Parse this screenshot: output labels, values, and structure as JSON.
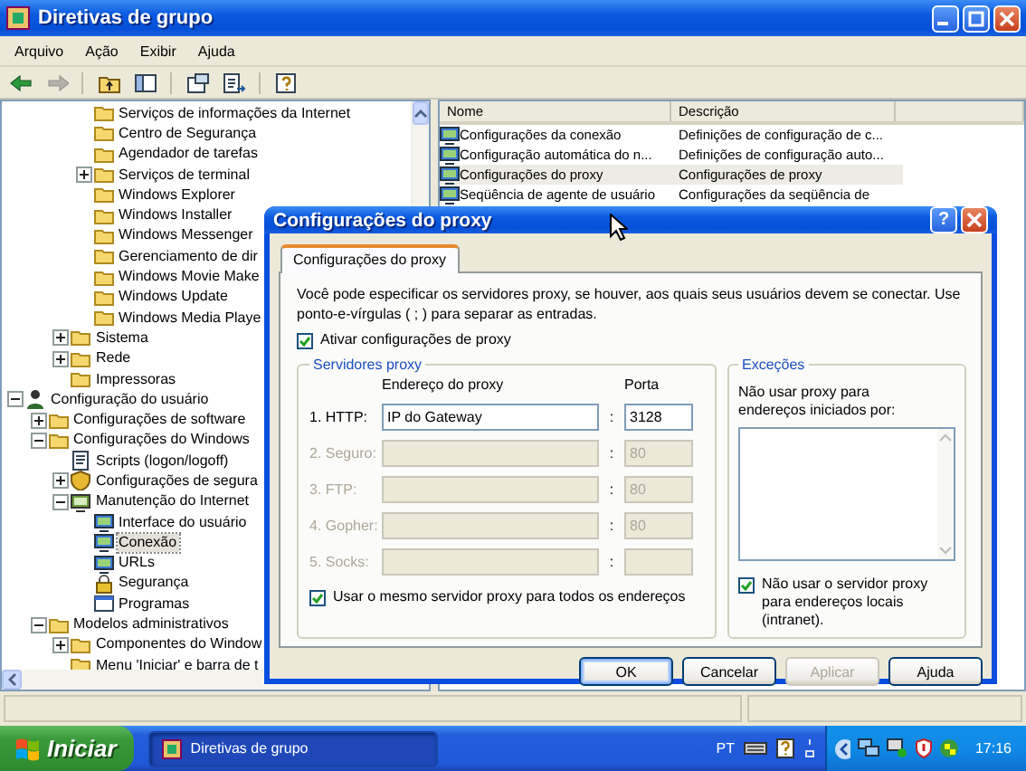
{
  "window": {
    "title": "Diretivas de grupo"
  },
  "menu": [
    {
      "label": "Arquivo"
    },
    {
      "label": "Ação"
    },
    {
      "label": "Exibir"
    },
    {
      "label": "Ajuda"
    }
  ],
  "toolbar": [
    {
      "kind": "back",
      "disabled": false
    },
    {
      "kind": "forward",
      "disabled": true
    },
    {
      "kind": "up",
      "disabled": false
    },
    {
      "kind": "tree",
      "disabled": false
    },
    {
      "kind": "properties",
      "disabled": false
    },
    {
      "kind": "export",
      "disabled": false
    },
    {
      "kind": "help",
      "disabled": false
    }
  ],
  "tree": [
    {
      "children": [
        {
          "children": [
            {
              "children": [
                {
                  "label": "Serviços de informações da Internet",
                  "kind": "folder",
                  "selected": false
                },
                {
                  "label": "Centro de Segurança",
                  "kind": "folder",
                  "selected": false
                },
                {
                  "label": "Agendador de tarefas",
                  "kind": "folder",
                  "selected": false
                },
                {
                  "label": "Serviços de terminal",
                  "kind": "folder",
                  "expanded": false,
                  "selected": false
                },
                {
                  "label": "Windows Explorer",
                  "kind": "folder",
                  "selected": false
                },
                {
                  "label": "Windows Installer",
                  "kind": "folder",
                  "selected": false
                },
                {
                  "label": "Windows Messenger",
                  "kind": "folder",
                  "selected": false
                },
                {
                  "label": "Gerenciamento de dir",
                  "kind": "folder",
                  "selected": false
                },
                {
                  "label": "Windows Movie Make",
                  "kind": "folder",
                  "selected": false
                },
                {
                  "label": "Windows Update",
                  "kind": "folder",
                  "selected": false
                },
                {
                  "label": "Windows Media Playe",
                  "kind": "folder",
                  "selected": false
                }
              ]
            },
            {
              "label": "Sistema",
              "kind": "folder",
              "expanded": false,
              "selected": false
            },
            {
              "label": "Rede",
              "kind": "folder",
              "expanded": false,
              "selected": false
            },
            {
              "label": "Impressoras",
              "kind": "folder",
              "selected": false
            }
          ]
        }
      ]
    },
    {
      "label": "Configuração do usuário",
      "kind": "user",
      "expanded": true,
      "selected": false,
      "children": [
        {
          "label": "Configurações de software",
          "kind": "folder",
          "expanded": false,
          "selected": false
        },
        {
          "label": "Configurações do Windows",
          "kind": "folder",
          "expanded": true,
          "selected": false,
          "children": [
            {
              "label": "Scripts (logon/logoff)",
              "kind": "document",
              "selected": false
            },
            {
              "label": "Configurações de segura",
              "kind": "shield",
              "expanded": false,
              "selected": false
            },
            {
              "label": "Manutenção do Internet",
              "kind": "computer",
              "expanded": true,
              "selected": false,
              "children": [
                {
                  "label": "Interface do usuário",
                  "kind": "monitor",
                  "selected": false
                },
                {
                  "label": "Conexão",
                  "kind": "monitor",
                  "selected": true
                },
                {
                  "label": "URLs",
                  "kind": "monitor",
                  "selected": false
                },
                {
                  "label": "Segurança",
                  "kind": "lock",
                  "selected": false
                },
                {
                  "label": "Programas",
                  "kind": "window",
                  "selected": false
                }
              ]
            }
          ]
        },
        {
          "label": "Modelos administrativos",
          "kind": "folder",
          "expanded": true,
          "selected": false,
          "children": [
            {
              "label": "Componentes do Window",
              "kind": "folder",
              "expanded": false,
              "selected": false
            },
            {
              "label": "Menu 'Iniciar' e barra de t",
              "kind": "folder",
              "selected": false
            }
          ]
        }
      ]
    }
  ],
  "list": {
    "columns": [
      "Nome",
      "Descrição"
    ],
    "rows": [
      {
        "name": "Configurações da conexão",
        "description": "Definições de configuração de c...",
        "selected": false
      },
      {
        "name": "Configuração automática do n...",
        "description": "Definições de configuração auto...",
        "selected": false
      },
      {
        "name": "Configurações do proxy",
        "description": "Configurações de proxy",
        "selected": true
      },
      {
        "name": "Seqüência de agente de usuário",
        "description": "Configurações da seqüência de",
        "selected": false
      }
    ]
  },
  "dialog": {
    "title": "Configurações do proxy",
    "help_button": "?",
    "tabs": [
      {
        "label": "Configurações do proxy",
        "selected": true
      }
    ],
    "intro": "Você pode especificar os servidores proxy, se houver, aos quais seus usuários devem se conectar. Use ponto-e-vírgulas ( ; ) para separar as entradas.",
    "enable_proxy": {
      "label": "Ativar configurações de proxy",
      "checked": true
    },
    "servers": {
      "title": "Servidores proxy",
      "address_heading": "Endereço do proxy",
      "port_heading": "Porta",
      "rows": [
        {
          "label": "1. HTTP:",
          "address": "IP do Gateway",
          "separator": ":",
          "port": "3128",
          "disabled": false
        },
        {
          "label": "2. Seguro:",
          "separator": ":",
          "port": "80",
          "disabled": true
        },
        {
          "label": "3. FTP:",
          "separator": ":",
          "port": "80",
          "disabled": true
        },
        {
          "label": "4. Gopher:",
          "separator": ":",
          "port": "80",
          "disabled": true
        },
        {
          "label": "5. Socks:",
          "separator": ":",
          "disabled": true
        }
      ],
      "same_proxy": {
        "label": "Usar o mesmo servidor proxy para todos os endereços",
        "checked": true
      }
    },
    "exceptions": {
      "title": "Exceções",
      "label": "Não usar proxy para endereços iniciados por:",
      "bypass_local": {
        "label": "Não usar o servidor proxy para endereços locais (intranet).",
        "checked": true
      }
    },
    "buttons": [
      {
        "label": "OK",
        "default": true,
        "disabled": false
      },
      {
        "label": "Cancelar",
        "default": false,
        "disabled": false
      },
      {
        "label": "Aplicar",
        "default": false,
        "disabled": true
      },
      {
        "label": "Ajuda",
        "default": false,
        "disabled": false
      }
    ]
  },
  "taskbar": {
    "start": "Iniciar",
    "tasks": [
      {
        "label": "Diretivas de grupo",
        "selected": true
      }
    ],
    "language": "PT",
    "clock": "17:16"
  }
}
